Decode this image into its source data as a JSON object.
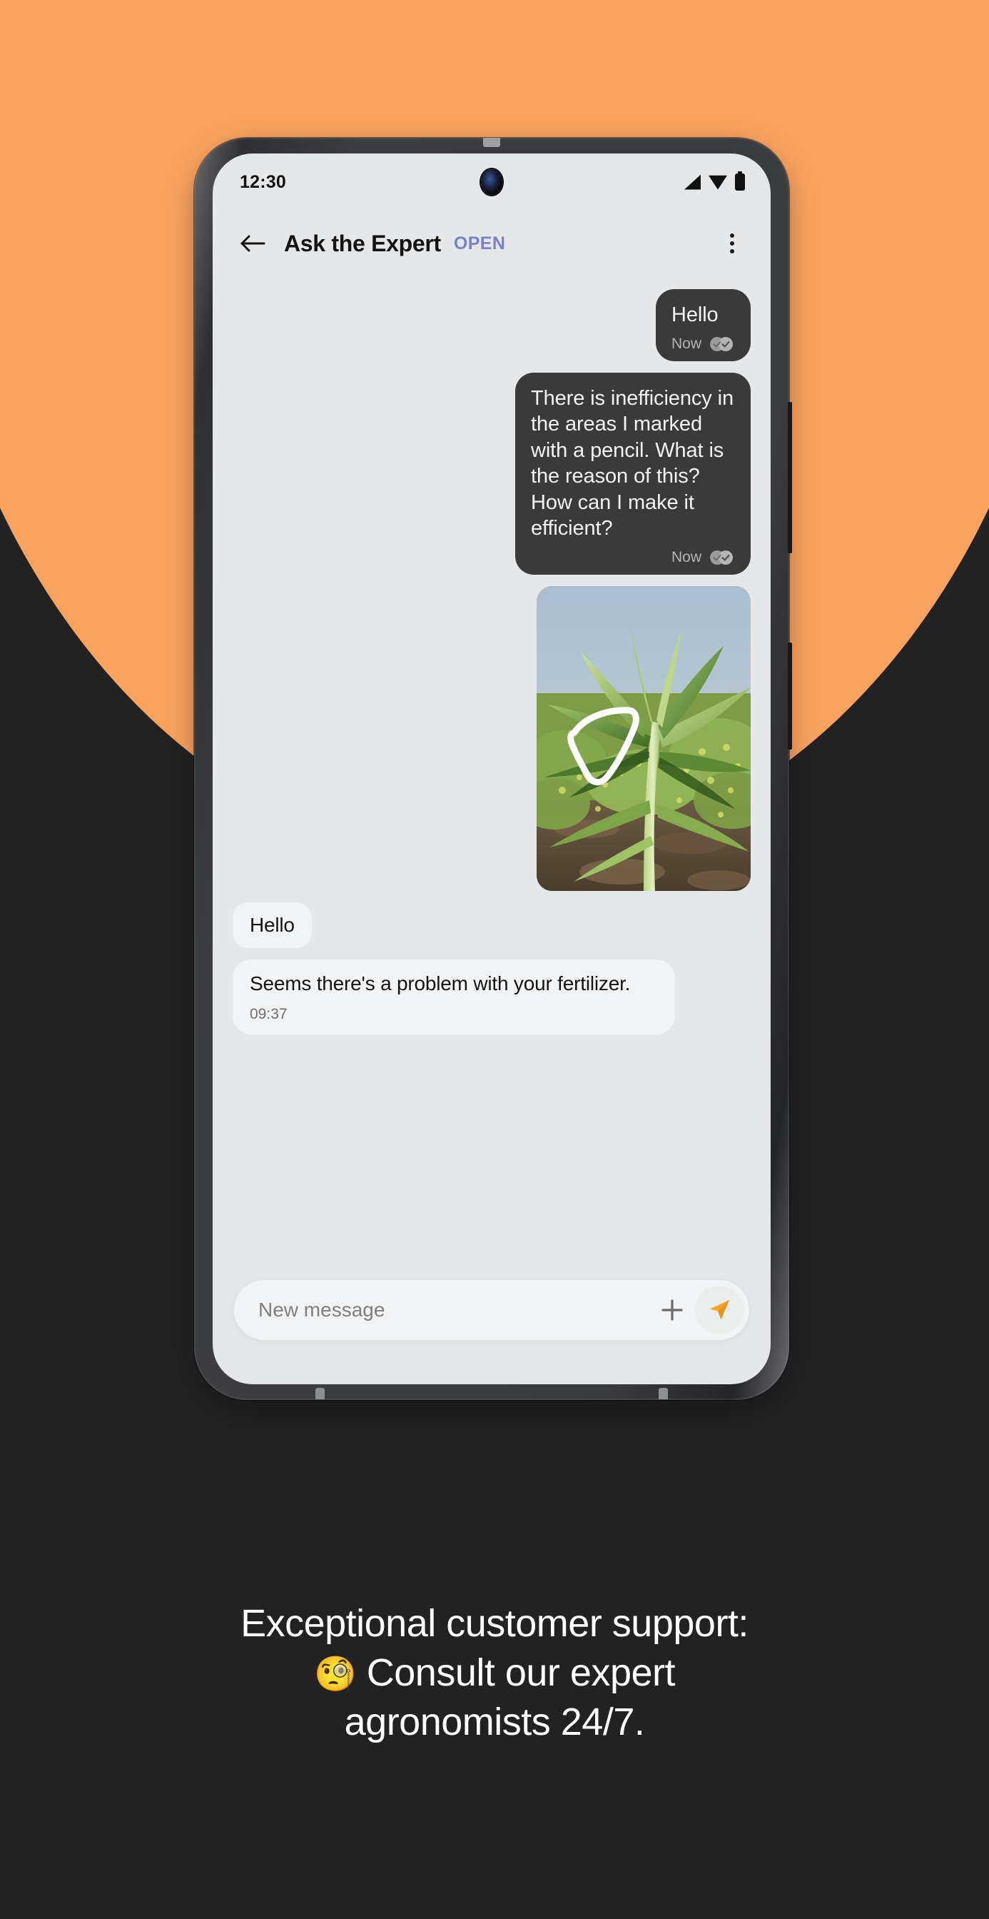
{
  "background": {
    "dark_color": "#222222",
    "accent_color": "#faa35f"
  },
  "phone": {
    "status_bar": {
      "time": "12:30",
      "icons": [
        "signal-icon",
        "wifi-icon",
        "battery-icon"
      ]
    },
    "app_bar": {
      "back_icon": "back-arrow-icon",
      "title": "Ask the Expert",
      "status_label": "OPEN",
      "status_color": "#7c80c6",
      "overflow_icon": "overflow-menu-icon"
    },
    "conversation": {
      "messages": [
        {
          "direction": "outgoing",
          "text": "Hello",
          "time": "Now",
          "receipt": "double-check-icon"
        },
        {
          "direction": "outgoing",
          "text": "There is inefficiency in the areas I marked with a pencil. What is the reason of this? How can I make it efficient?",
          "time": "Now",
          "receipt": "double-check-icon"
        },
        {
          "direction": "outgoing",
          "type": "photo",
          "alt": "Corn plant in field with white hand-drawn triangle annotation"
        },
        {
          "direction": "incoming",
          "text": "Hello"
        },
        {
          "direction": "incoming",
          "text": "Seems there's a problem with your fertilizer.",
          "time": "09:37"
        }
      ]
    },
    "composer": {
      "placeholder": "New message",
      "value": "",
      "attach_icon": "plus-icon",
      "send_icon": "send-paper-plane-icon",
      "send_color": "#f6a623"
    }
  },
  "caption": {
    "line1": "Exceptional customer support:",
    "emoji": "🧐",
    "line2": "Consult our expert",
    "line3": "agronomists 24/7."
  }
}
